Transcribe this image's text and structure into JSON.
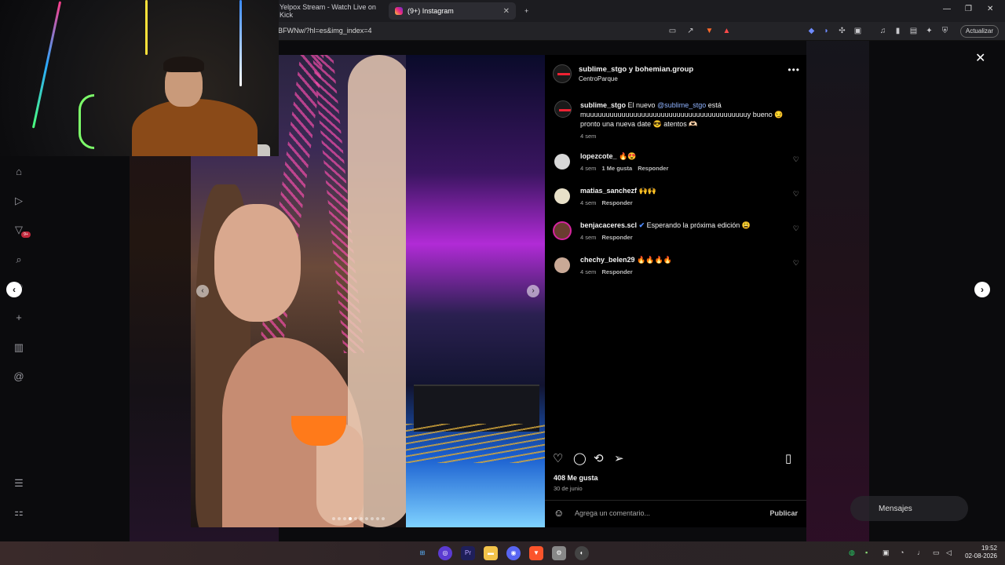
{
  "browser": {
    "tabs": [
      {
        "title": "Yelpox Stream - Watch Live on Kick",
        "active": false
      },
      {
        "title": "(9+) Instagram",
        "active": true
      }
    ],
    "new_tab_label": "+",
    "url": "BFWNw/?hl=es&img_index=4",
    "update_label": "Actualizar"
  },
  "post": {
    "header_user": "sublime_stgo y bohemian.group",
    "location": "CentroParque",
    "more_label": "•••",
    "caption_user": "sublime_stgo",
    "caption_pre": "El nuevo",
    "caption_mention": "@sublime_stgo",
    "caption_post": "está muuuuuuuuuuuuuuuuuuuuuuuuuuuuuuuuuuuuuuuuuy bueno 😏 pronto una nueva date 😎 atentos 🫶🏻",
    "caption_time": "4 sem",
    "comments": [
      {
        "user": "lopezcote_",
        "text": "🔥😍",
        "time": "4 sem",
        "likes": "1 Me gusta",
        "reply": "Responder"
      },
      {
        "user": "matias_sanchezf",
        "text": "🙌🙌",
        "time": "4 sem",
        "likes": "",
        "reply": "Responder"
      },
      {
        "user": "benjacaceres.scl",
        "text": "Esperando la próxima edición 😩",
        "time": "4 sem",
        "likes": "",
        "reply": "Responder"
      },
      {
        "user": "chechy_belen29",
        "text": "🔥🔥🔥🔥",
        "time": "4 sem",
        "likes": "",
        "reply": "Responder"
      }
    ],
    "likes_count": "408 Me gusta",
    "date": "30 de junio",
    "comment_placeholder": "Agrega un comentario...",
    "publish_label": "Publicar",
    "carousel_index": 4,
    "carousel_total": 10
  },
  "overlay": {
    "messages_label": "Mensajes",
    "notification_badge": "9+"
  },
  "taskbar": {
    "time": "19:52",
    "date": "02-08-2026"
  },
  "colors": {
    "panel_bg": "#000000",
    "mention": "#8fb3ff",
    "accent_badge": "#c0273b"
  }
}
